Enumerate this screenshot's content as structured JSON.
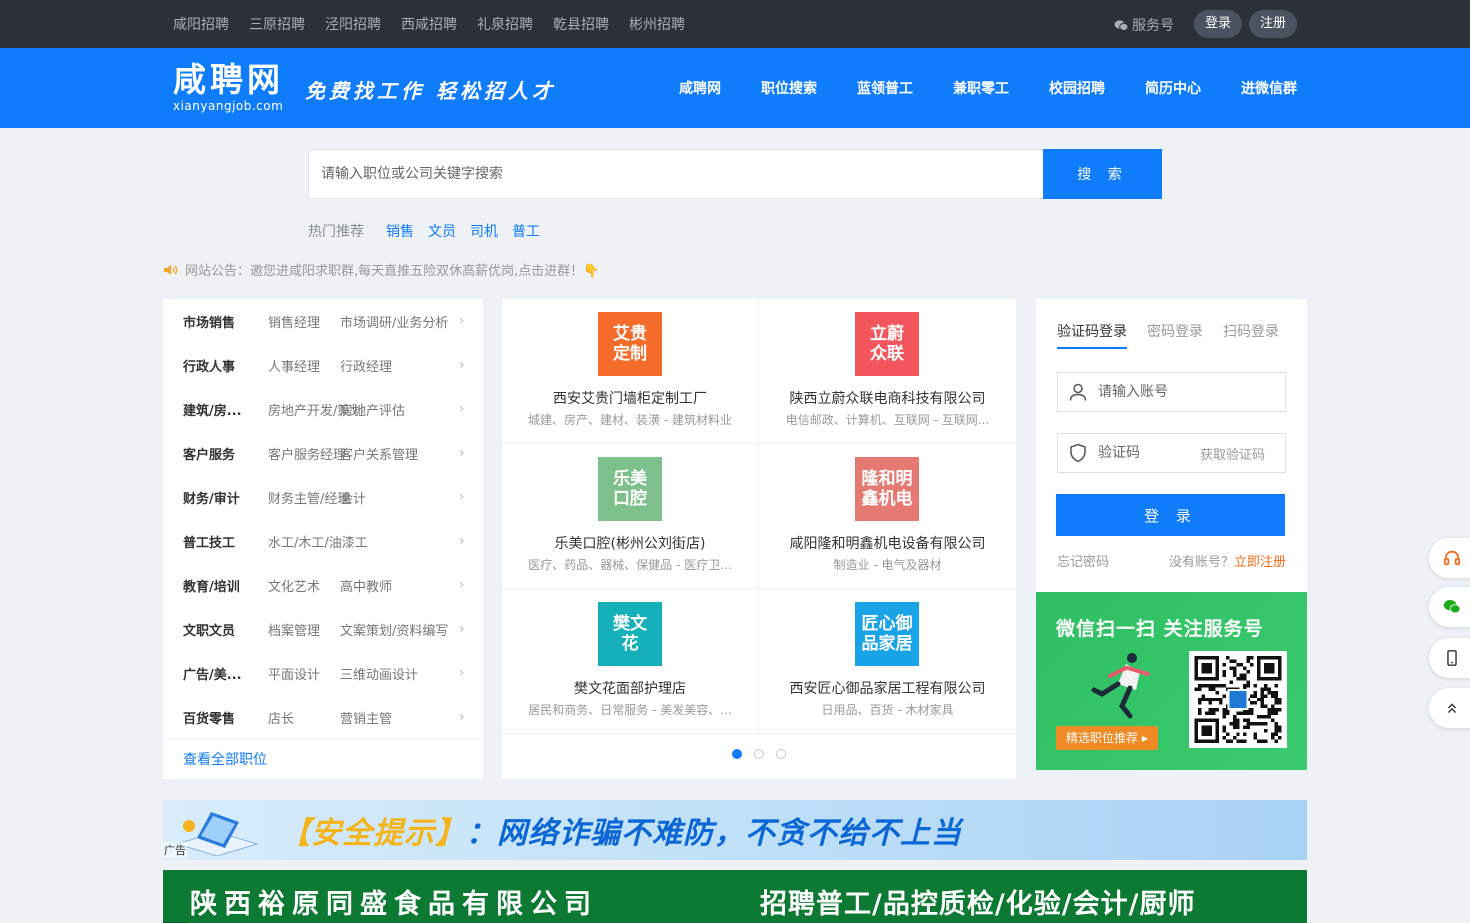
{
  "topbar": {
    "cities": [
      "咸阳招聘",
      "三原招聘",
      "泾阳招聘",
      "西咸招聘",
      "礼泉招聘",
      "乾县招聘",
      "彬州招聘"
    ],
    "service": "服务号",
    "login": "登录",
    "register": "注册"
  },
  "header": {
    "logo_main": "咸聘网",
    "logo_sub": "xianyangjob.com",
    "slogan": "免费找工作 轻松招人才",
    "nav": [
      "咸聘网",
      "职位搜索",
      "蓝领普工",
      "兼职零工",
      "校园招聘",
      "简历中心",
      "进微信群"
    ]
  },
  "search": {
    "placeholder": "请输入职位或公司关键字搜索",
    "button": "搜 索",
    "hot_label": "热门推荐",
    "hot": [
      "销售",
      "文员",
      "司机",
      "普工"
    ]
  },
  "notice": {
    "text": "网站公告：邀您进咸阳求职群,每天直推五险双休高薪优岗,点击进群！👇"
  },
  "categories": {
    "items": [
      {
        "name": "市场销售",
        "sub1": "销售经理",
        "sub2": "市场调研/业务分析"
      },
      {
        "name": "行政人事",
        "sub1": "人事经理",
        "sub2": "行政经理"
      },
      {
        "name": "建筑/房...",
        "sub1": "房地产开发/策划",
        "sub2": "房地产评估"
      },
      {
        "name": "客户服务",
        "sub1": "客户服务经理",
        "sub2": "客户关系管理"
      },
      {
        "name": "财务/审计",
        "sub1": "财务主管/经理",
        "sub2": "会计"
      },
      {
        "name": "普工技工",
        "sub1": "水工/木工/油漆工",
        "sub2": ""
      },
      {
        "name": "教育/培训",
        "sub1": "文化艺术",
        "sub2": "高中教师"
      },
      {
        "name": "文职文员",
        "sub1": "档案管理",
        "sub2": "文案策划/资料编写"
      },
      {
        "name": "广告/美...",
        "sub1": "平面设计",
        "sub2": "三维动画设计"
      },
      {
        "name": "百货零售",
        "sub1": "店长",
        "sub2": "营销主管"
      }
    ],
    "view_all": "查看全部职位"
  },
  "companies": [
    {
      "logo": "艾贵\n定制",
      "color": "#f56c2a",
      "name": "西安艾贵门墙柜定制工厂",
      "info": "城建、房产、建材、装潢 - 建筑材料业"
    },
    {
      "logo": "立蔚\n众联",
      "color": "#f2555c",
      "name": "陕西立蔚众联电商科技有限公司",
      "info": "电信邮政、计算机、互联网 - 互联网..."
    },
    {
      "logo": "乐美\n口腔",
      "color": "#7ec08b",
      "name": "乐美口腔(彬州公刘街店)",
      "info": "医疗、药品、器械、保健品 - 医疗卫..."
    },
    {
      "logo": "隆和明\n鑫机电",
      "color": "#e57a72",
      "name": "咸阳隆和明鑫机电设备有限公司",
      "info": "制造业 - 电气及器材"
    },
    {
      "logo": "樊文\n花",
      "color": "#16b0ba",
      "name": "樊文花面部护理店",
      "info": "居民和商务、日常服务 - 美发美容、..."
    },
    {
      "logo": "匠心御\n品家居",
      "color": "#1aa4e8",
      "name": "西安匠心御品家居工程有限公司",
      "info": "日用品、百货 - 木材家具"
    }
  ],
  "carousel_count": 3,
  "login": {
    "tabs": [
      "验证码登录",
      "密码登录",
      "扫码登录"
    ],
    "account_placeholder": "请输入账号",
    "code_placeholder": "验证码",
    "get_code": "获取验证码",
    "button": "登 录",
    "forgot": "忘记密码",
    "no_account": "没有账号？",
    "register_now": "立即注册"
  },
  "wechat": {
    "title": "微信扫一扫 关注服务号",
    "tag": "精选职位推荐 ▸"
  },
  "banners": {
    "ad": "广告",
    "safety_bracket": "【安全提示】",
    "safety_text": "：网络诈骗不难防，不贪不给不上当",
    "company": "陕西裕原同盛食品有限公司",
    "recruit": "招聘普工/品控质检/化验/会计/厨师"
  },
  "colors": {
    "primary": "#0f7cfb",
    "topbar": "#2b3039",
    "accent": "#f56c1b"
  }
}
